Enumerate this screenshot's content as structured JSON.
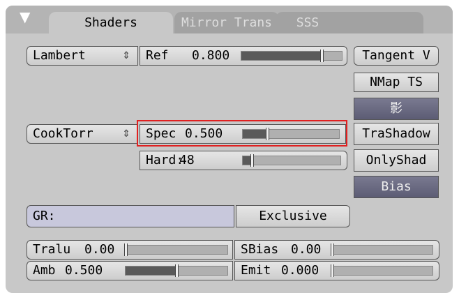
{
  "tabs": {
    "collapse_icon": "triangle-down-icon",
    "items": [
      {
        "label": "Shaders",
        "active": true
      },
      {
        "label": "Mirror Trans",
        "active": false
      },
      {
        "label": "SSS",
        "active": false
      }
    ]
  },
  "diffuse": {
    "shader_menu": "Lambert",
    "ref_label": "Ref",
    "ref_value": "0.800",
    "ref_fraction": 0.8
  },
  "specular": {
    "shader_menu": "CookTorr",
    "spec_label": "Spec",
    "spec_value": "0.500",
    "spec_fraction": 0.25,
    "hard_label": "Hard:",
    "hard_value": "48",
    "hard_fraction": 0.09
  },
  "toggles": {
    "tangent": "Tangent V",
    "nmap": "NMap TS",
    "shadow": "影",
    "trashadow": "TraShadow",
    "onlyshad": "OnlyShad",
    "bias": "Bias"
  },
  "group": {
    "label": "GR:",
    "value": "",
    "exclusive": "Exclusive"
  },
  "params": {
    "tralu": {
      "label": "Tralu",
      "value": "0.00",
      "fraction": 0.0
    },
    "sbias": {
      "label": "SBias",
      "value": "0.00",
      "fraction": 0.0
    },
    "amb": {
      "label": "Amb",
      "value": "0.500",
      "fraction": 0.5
    },
    "emit": {
      "label": "Emit",
      "value": "0.000",
      "fraction": 0.0
    }
  },
  "colors": {
    "highlight": "#e02020",
    "dark_button": "#6a6a82"
  }
}
